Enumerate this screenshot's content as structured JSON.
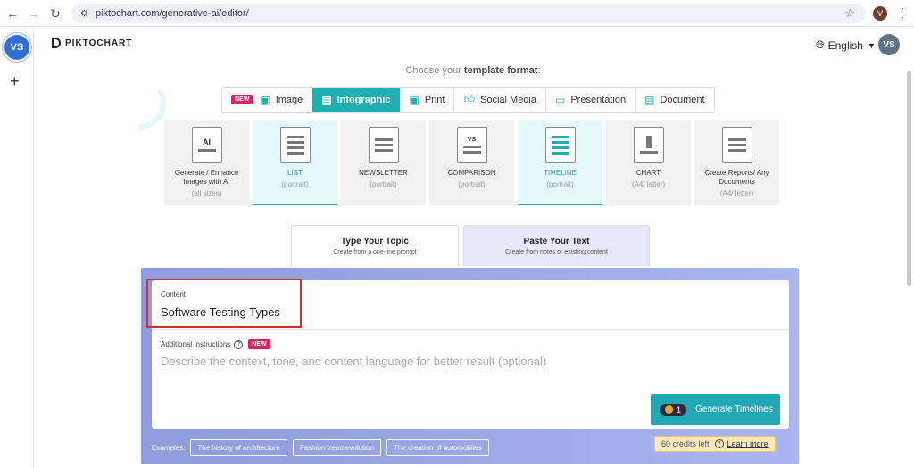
{
  "browser": {
    "url": "piktochart.com/generative-ai/editor/",
    "profile_initial": "V"
  },
  "rail": {
    "avatar_initials": "VS",
    "add_symbol": "+"
  },
  "header": {
    "logo_text": "PIKTOCHART",
    "language": "English",
    "avatar_initials": "VS"
  },
  "choose": {
    "prefix": "Choose your",
    "bold": "template format",
    "suffix": ":"
  },
  "format_tabs": [
    {
      "label": "Image",
      "badge": "NEW",
      "icon": "image-icon"
    },
    {
      "label": "Infographic",
      "icon": "infographic-icon",
      "active": true
    },
    {
      "label": "Print",
      "icon": "print-icon"
    },
    {
      "label": "Social Media",
      "icon": "like-icon"
    },
    {
      "label": "Presentation",
      "icon": "presentation-icon"
    },
    {
      "label": "Document",
      "icon": "document-icon"
    }
  ],
  "cards": [
    {
      "title": "Generate / Enhance Images with AI",
      "sub": "(all sizes)",
      "thumb": "AI"
    },
    {
      "title": "LIST",
      "sub": "(portrait)",
      "selected": true
    },
    {
      "title": "NEWSLETTER",
      "sub": "(portrait)"
    },
    {
      "title": "COMPARISON",
      "sub": "(portrait)",
      "thumb": "VS"
    },
    {
      "title": "TIMELINE",
      "sub": "(portrait)",
      "selected": true
    },
    {
      "title": "CHART",
      "sub": "(A4/ letter)"
    },
    {
      "title": "Create Reports/ Any Documents",
      "sub": "(A4/ letter)"
    }
  ],
  "input_tabs": [
    {
      "title": "Type Your Topic",
      "sub": "Create from a one-line prompt"
    },
    {
      "title": "Paste Your Text",
      "sub": "Create from notes or existing content"
    }
  ],
  "form": {
    "content_label": "Content",
    "content_value": "Software Testing Types",
    "additional_label": "Additional Instructions",
    "additional_badge": "NEW",
    "additional_placeholder": "Describe the context, tone, and content language for better result (optional)",
    "generate_cost": "1",
    "generate_label": "Generate Timelines"
  },
  "examples": {
    "label": "Examples:",
    "chips": [
      "The history of architecture",
      "Fashion trend evolution",
      "The creation of automobiles"
    ]
  },
  "credits": {
    "text": "60 credits left",
    "link": "Learn more"
  }
}
